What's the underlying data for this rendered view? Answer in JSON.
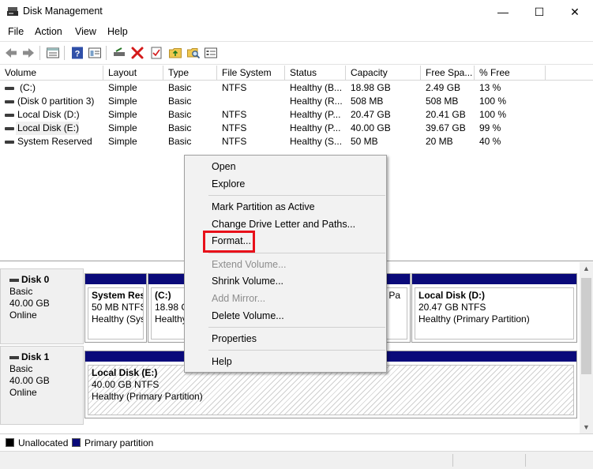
{
  "window": {
    "title": "Disk Management",
    "controls": {
      "minimize": "—",
      "maximize": "☐",
      "close": "✕"
    }
  },
  "menubar": [
    {
      "label": "File"
    },
    {
      "label": "Action"
    },
    {
      "label": "View"
    },
    {
      "label": "Help"
    }
  ],
  "toolbar": {
    "icons": [
      "back-arrow-icon",
      "forward-arrow-icon",
      "properties-list-icon",
      "help-icon",
      "console-tree-icon",
      "connect-icon",
      "delete-icon",
      "checklist-icon",
      "up-folder-icon",
      "search-folder-icon",
      "settings-list-icon"
    ]
  },
  "volumes": {
    "columns": [
      "Volume",
      "Layout",
      "Type",
      "File System",
      "Status",
      "Capacity",
      "Free Spa...",
      "% Free"
    ],
    "rows": [
      {
        "volume": "(C:)",
        "layout": "Simple",
        "type": "Basic",
        "fs": "NTFS",
        "status": "Healthy (B...",
        "capacity": "18.98 GB",
        "free": "2.49 GB",
        "pct": "13 %"
      },
      {
        "volume": "(Disk 0 partition 3)",
        "layout": "Simple",
        "type": "Basic",
        "fs": "",
        "status": "Healthy (R...",
        "capacity": "508 MB",
        "free": "508 MB",
        "pct": "100 %"
      },
      {
        "volume": "Local Disk (D:)",
        "layout": "Simple",
        "type": "Basic",
        "fs": "NTFS",
        "status": "Healthy (P...",
        "capacity": "20.47 GB",
        "free": "20.41 GB",
        "pct": "100 %"
      },
      {
        "volume": "Local Disk (E:)",
        "layout": "Simple",
        "type": "Basic",
        "fs": "NTFS",
        "status": "Healthy (P...",
        "capacity": "40.00 GB",
        "free": "39.67 GB",
        "pct": "99 %"
      },
      {
        "volume": "System Reserved",
        "layout": "Simple",
        "type": "Basic",
        "fs": "NTFS",
        "status": "Healthy (S...",
        "capacity": "50 MB",
        "free": "20 MB",
        "pct": "40 %"
      }
    ]
  },
  "disks": [
    {
      "name": "Disk 0",
      "type": "Basic",
      "size": "40.00 GB",
      "state": "Online",
      "partitions": [
        {
          "name": "System Res",
          "size": "50 MB NTFS",
          "status": "Healthy (Sys"
        },
        {
          "name": "(C:)",
          "size": "18.98 G",
          "status": "Healthy"
        },
        {
          "name": "",
          "size": "",
          "status": "y Pa"
        },
        {
          "name": "Local Disk  (D:)",
          "size": "20.47 GB NTFS",
          "status": "Healthy (Primary Partition)"
        }
      ]
    },
    {
      "name": "Disk 1",
      "type": "Basic",
      "size": "40.00 GB",
      "state": "Online",
      "partitions": [
        {
          "name": "Local Disk  (E:)",
          "size": "40.00 GB NTFS",
          "status": "Healthy (Primary Partition)"
        }
      ]
    }
  ],
  "legend": [
    {
      "label": "Unallocated",
      "color": "#000000"
    },
    {
      "label": "Primary partition",
      "color": "#0a0a7a"
    }
  ],
  "context_menu": {
    "items": [
      {
        "label": "Open",
        "enabled": true
      },
      {
        "label": "Explore",
        "enabled": true
      },
      {
        "label": "Mark Partition as Active",
        "enabled": true
      },
      {
        "label": "Change Drive Letter and Paths...",
        "enabled": true
      },
      {
        "label": "Format...",
        "enabled": true,
        "highlighted": true
      },
      {
        "label": "Extend Volume...",
        "enabled": false
      },
      {
        "label": "Shrink Volume...",
        "enabled": true
      },
      {
        "label": "Add Mirror...",
        "enabled": false
      },
      {
        "label": "Delete Volume...",
        "enabled": true
      },
      {
        "label": "Properties",
        "enabled": true
      },
      {
        "label": "Help",
        "enabled": true
      }
    ]
  },
  "colors": {
    "primary_partition": "#0a0a7a",
    "highlight_border": "#e8101a",
    "delete_icon": "#d41a1a"
  }
}
